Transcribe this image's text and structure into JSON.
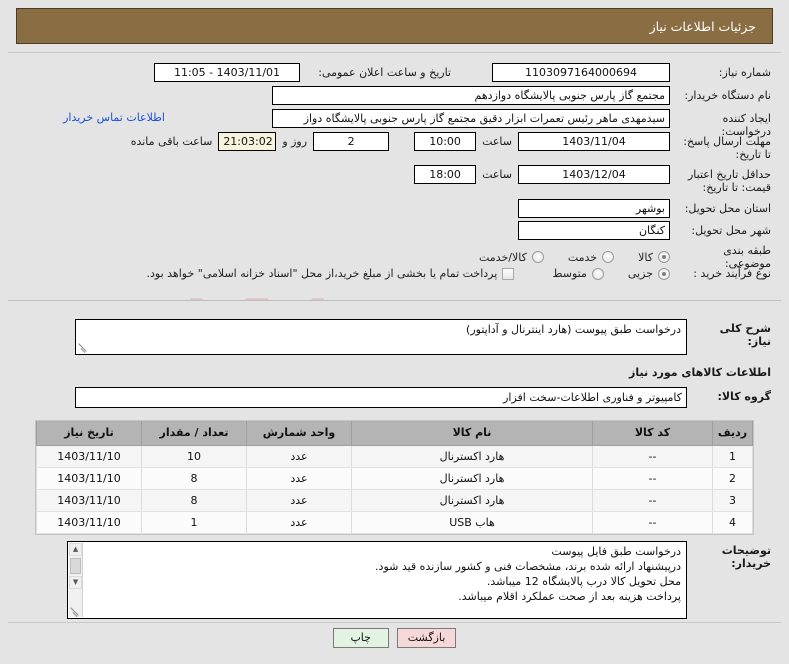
{
  "header": {
    "title": "جزئیات اطلاعات نیاز"
  },
  "form": {
    "need_number_label": "شماره نیاز:",
    "need_number_value": "1103097164000694",
    "announce_label": "تاریخ و ساعت اعلان عمومی:",
    "announce_value": "11:05 - 1403/11/01",
    "buyer_org_label": "نام دستگاه خریدار:",
    "buyer_org_value": "مجتمع گاز پارس جنوبی  پالایشگاه دوازدهم",
    "creator_label": "ایجاد کننده درخواست:",
    "creator_value": "سیدمهدی ماهر رئیس تعمرات ابزار دقیق مجتمع گاز پارس جنوبی  پالایشگاه دواز",
    "contact_link": "اطلاعات تماس خریدار",
    "deadline_label": "مهلت ارسال پاسخ: تا تاریخ:",
    "deadline_date": "1403/11/04",
    "deadline_hour_label": "ساعت",
    "deadline_hour": "10:00",
    "days_remaining": "2",
    "days_unit": "روز و",
    "time_remaining": "21:03:02",
    "time_remaining_suffix": "ساعت باقی مانده",
    "validity_label": "حداقل تاریخ اعتبار قیمت: تا تاریخ:",
    "validity_date": "1403/12/04",
    "validity_hour_label": "ساعت",
    "validity_hour": "18:00",
    "province_label": "استان محل تحویل:",
    "province_value": "بوشهر",
    "city_label": "شهر محل تحویل:",
    "city_value": "کنگان",
    "category_label": "طبقه بندی موضوعی:",
    "category_options": [
      "کالا",
      "خدمت",
      "کالا/خدمت"
    ],
    "category_selected": "کالا",
    "process_label": "نوع فرآیند خرید :",
    "process_options": [
      "جزیی",
      "متوسط"
    ],
    "process_selected": "جزیی",
    "treasury_checkbox_text": "پرداخت تمام یا بخشی از مبلغ خرید،از محل \"اسناد خزانه اسلامی\" خواهد بود.",
    "treasury_checked": false
  },
  "description": {
    "summary_label": "شرح کلی نیاز:",
    "summary_value": "درخواست طبق پیوست (هارد اینترنال و آداپتور)",
    "goods_section_title": "اطلاعات کالاهای مورد نیاز",
    "group_label": "گروه کالا:",
    "group_value": "کامپیوتر و فناوری اطلاعات-سخت افزار"
  },
  "table": {
    "columns": [
      "ردیف",
      "کد کالا",
      "نام کالا",
      "واحد شمارش",
      "تعداد / مقدار",
      "تاریخ نیاز"
    ],
    "rows": [
      {
        "index": "1",
        "code": "--",
        "name": "هارد اکسترنال",
        "unit": "عدد",
        "qty": "10",
        "date": "1403/11/10"
      },
      {
        "index": "2",
        "code": "--",
        "name": "هارد اکسترنال",
        "unit": "عدد",
        "qty": "8",
        "date": "1403/11/10"
      },
      {
        "index": "3",
        "code": "--",
        "name": "هارد اکسترنال",
        "unit": "عدد",
        "qty": "8",
        "date": "1403/11/10"
      },
      {
        "index": "4",
        "code": "--",
        "name": "هاب USB",
        "unit": "عدد",
        "qty": "1",
        "date": "1403/11/10"
      }
    ]
  },
  "notes": {
    "label": "توضیحات خریدار:",
    "lines": [
      "درخواست طبق فایل پیوست",
      "درپیشنهاد ارائه شده برند، مشخصات فنی و کشور سازنده قید شود.",
      "محل تحویل کالا درب پالایشگاه 12 میباشد.",
      "پرداخت هزینه بعد از صحت عملکرد اقلام میباشد."
    ]
  },
  "buttons": {
    "print": "چاپ",
    "back": "بازگشت"
  },
  "watermark": {
    "text": "AriaTender.net"
  },
  "colors": {
    "header_bg": "#8b6d43",
    "page_bg": "#e4e4e4",
    "link": "#1a4fd6",
    "table_head": "#b4b4b4"
  }
}
